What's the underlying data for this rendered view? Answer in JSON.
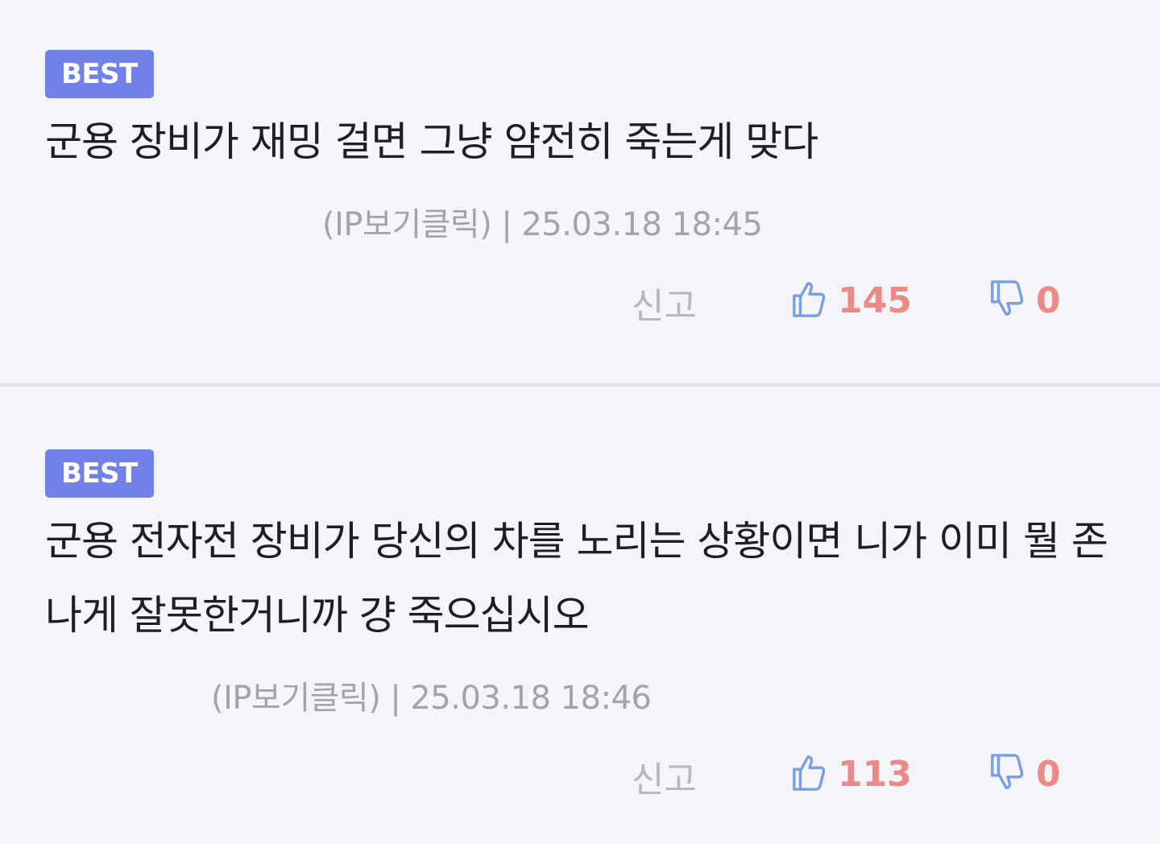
{
  "comments": [
    {
      "badge": "BEST",
      "text": "군용 장비가 재밍 걸면 그냥 얌전히 죽는게 맞다",
      "ip_label": "(IP보기클릭)",
      "separator": "|",
      "date": "25.03.18 18:45",
      "report_label": "신고",
      "likes": "145",
      "dislikes": "0"
    },
    {
      "badge": "BEST",
      "text": "군용 전자전 장비가 당신의 차를 노리는 상황이면 니가 이미 뭘 존나게 잘못한거니까 걍 죽으십시오",
      "ip_label": "(IP보기클릭)",
      "separator": "|",
      "date": "25.03.18 18:46",
      "report_label": "신고",
      "likes": "113",
      "dislikes": "0"
    }
  ],
  "colors": {
    "badge_bg": "#7281e8",
    "count": "#eb8a87",
    "icon_stroke": "#7a9fe0",
    "background": "#f5f5f9"
  },
  "icons": {
    "like": "thumbs-up-icon",
    "dislike": "thumbs-down-icon"
  }
}
